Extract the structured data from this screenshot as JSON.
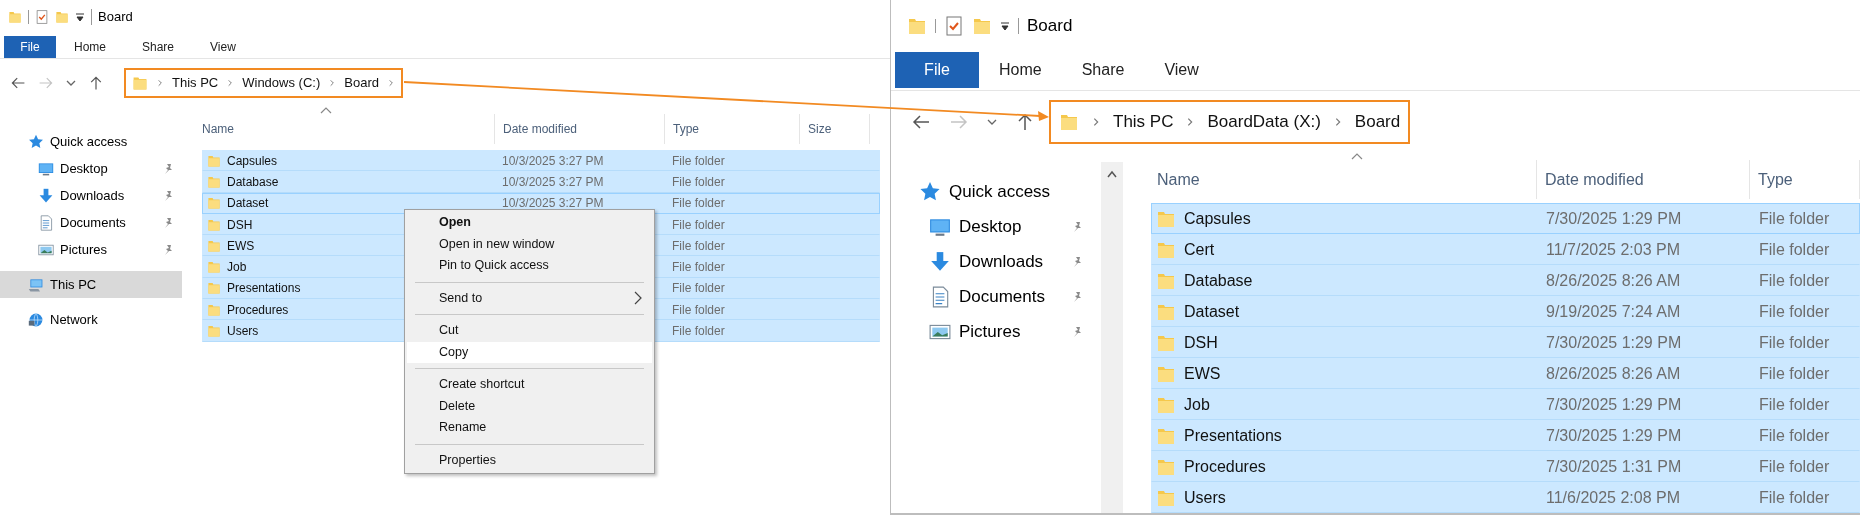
{
  "windows": [
    {
      "title": "Board",
      "ribbon_tabs": [
        {
          "label": "File",
          "kind": "file"
        },
        {
          "label": "Home",
          "kind": "tab"
        },
        {
          "label": "Share",
          "kind": "tab"
        },
        {
          "label": "View",
          "kind": "tab"
        }
      ],
      "breadcrumb": [
        "This PC",
        "Windows (C:)",
        "Board"
      ],
      "trailing_chevron": true,
      "nav": [
        {
          "label": "Quick access",
          "kind": "quick",
          "pinned": false,
          "selected": false,
          "children": [
            {
              "label": "Desktop",
              "kind": "desktop",
              "pinned": true,
              "selected": false
            },
            {
              "label": "Downloads",
              "kind": "downloads",
              "pinned": true,
              "selected": false
            },
            {
              "label": "Documents",
              "kind": "documents",
              "pinned": true,
              "selected": false
            },
            {
              "label": "Pictures",
              "kind": "pictures",
              "pinned": true,
              "selected": false
            }
          ]
        },
        {
          "label": "This PC",
          "kind": "pc",
          "pinned": false,
          "selected": true
        },
        {
          "label": "Network",
          "kind": "network",
          "pinned": false,
          "selected": false
        }
      ],
      "columns": [
        "Name",
        "Date modified",
        "Type",
        "Size"
      ],
      "rows": [
        {
          "name": "Capsules",
          "date": "10/3/2025 3:27 PM",
          "type": "File folder",
          "selected": true,
          "focused": false
        },
        {
          "name": "Database",
          "date": "10/3/2025 3:27 PM",
          "type": "File folder",
          "selected": true,
          "focused": false
        },
        {
          "name": "Dataset",
          "date": "10/3/2025 3:27 PM",
          "type": "File folder",
          "selected": true,
          "focused": true
        },
        {
          "name": "DSH",
          "type": "File folder",
          "selected": true,
          "focused": false
        },
        {
          "name": "EWS",
          "type": "File folder",
          "selected": true,
          "focused": false
        },
        {
          "name": "Job",
          "type": "File folder",
          "selected": true,
          "focused": false
        },
        {
          "name": "Presentations",
          "type": "File folder",
          "selected": true,
          "focused": false
        },
        {
          "name": "Procedures",
          "type": "File folder",
          "selected": true,
          "focused": false
        },
        {
          "name": "Users",
          "type": "File folder",
          "selected": true,
          "focused": false
        }
      ],
      "context_menu": {
        "items": [
          {
            "kind": "item",
            "label": "Open",
            "bold": true,
            "submenu": false,
            "selected": false
          },
          {
            "kind": "item",
            "label": "Open in new window",
            "bold": false,
            "submenu": false,
            "selected": false
          },
          {
            "kind": "item",
            "label": "Pin to Quick access",
            "bold": false,
            "submenu": false,
            "selected": false
          },
          {
            "kind": "separator"
          },
          {
            "kind": "item",
            "label": "Send to",
            "bold": false,
            "submenu": true,
            "selected": false
          },
          {
            "kind": "separator"
          },
          {
            "kind": "item",
            "label": "Cut",
            "bold": false,
            "submenu": false,
            "selected": false
          },
          {
            "kind": "item",
            "label": "Copy",
            "bold": false,
            "submenu": false,
            "selected": true
          },
          {
            "kind": "separator"
          },
          {
            "kind": "item",
            "label": "Create shortcut",
            "bold": false,
            "submenu": false,
            "selected": false
          },
          {
            "kind": "item",
            "label": "Delete",
            "bold": false,
            "submenu": false,
            "selected": false
          },
          {
            "kind": "item",
            "label": "Rename",
            "bold": false,
            "submenu": false,
            "selected": false
          },
          {
            "kind": "separator"
          },
          {
            "kind": "item",
            "label": "Properties",
            "bold": false,
            "submenu": false,
            "selected": false
          }
        ]
      }
    },
    {
      "title": "Board",
      "ribbon_tabs": [
        {
          "label": "File",
          "kind": "file"
        },
        {
          "label": "Home",
          "kind": "tab"
        },
        {
          "label": "Share",
          "kind": "tab"
        },
        {
          "label": "View",
          "kind": "tab"
        }
      ],
      "breadcrumb": [
        "This PC",
        "BoardData (X:)",
        "Board"
      ],
      "trailing_chevron": false,
      "nav": [
        {
          "label": "Quick access",
          "kind": "quick",
          "pinned": false,
          "selected": false,
          "children": [
            {
              "label": "Desktop",
              "kind": "desktop",
              "pinned": true,
              "selected": false
            },
            {
              "label": "Downloads",
              "kind": "downloads",
              "pinned": true,
              "selected": false
            },
            {
              "label": "Documents",
              "kind": "documents",
              "pinned": true,
              "selected": false
            },
            {
              "label": "Pictures",
              "kind": "pictures",
              "pinned": true,
              "selected": false
            }
          ]
        }
      ],
      "columns": [
        "Name",
        "Date modified",
        "Type"
      ],
      "rows": [
        {
          "name": "Capsules",
          "date": "7/30/2025 1:29 PM",
          "type": "File folder",
          "selected": true,
          "focused": true
        },
        {
          "name": "Cert",
          "date": "11/7/2025 2:03 PM",
          "type": "File folder",
          "selected": true,
          "focused": false
        },
        {
          "name": "Database",
          "date": "8/26/2025 8:26 AM",
          "type": "File folder",
          "selected": true,
          "focused": false
        },
        {
          "name": "Dataset",
          "date": "9/19/2025 7:24 AM",
          "type": "File folder",
          "selected": true,
          "focused": false
        },
        {
          "name": "DSH",
          "date": "7/30/2025 1:29 PM",
          "type": "File folder",
          "selected": true,
          "focused": false
        },
        {
          "name": "EWS",
          "date": "8/26/2025 8:26 AM",
          "type": "File folder",
          "selected": true,
          "focused": false
        },
        {
          "name": "Job",
          "date": "7/30/2025 1:29 PM",
          "type": "File folder",
          "selected": true,
          "focused": false
        },
        {
          "name": "Presentations",
          "date": "7/30/2025 1:29 PM",
          "type": "File folder",
          "selected": true,
          "focused": false
        },
        {
          "name": "Procedures",
          "date": "7/30/2025 1:31 PM",
          "type": "File folder",
          "selected": true,
          "focused": false
        },
        {
          "name": "Users",
          "date": "11/6/2025 2:08 PM",
          "type": "File folder",
          "selected": true,
          "focused": false
        }
      ]
    }
  ]
}
